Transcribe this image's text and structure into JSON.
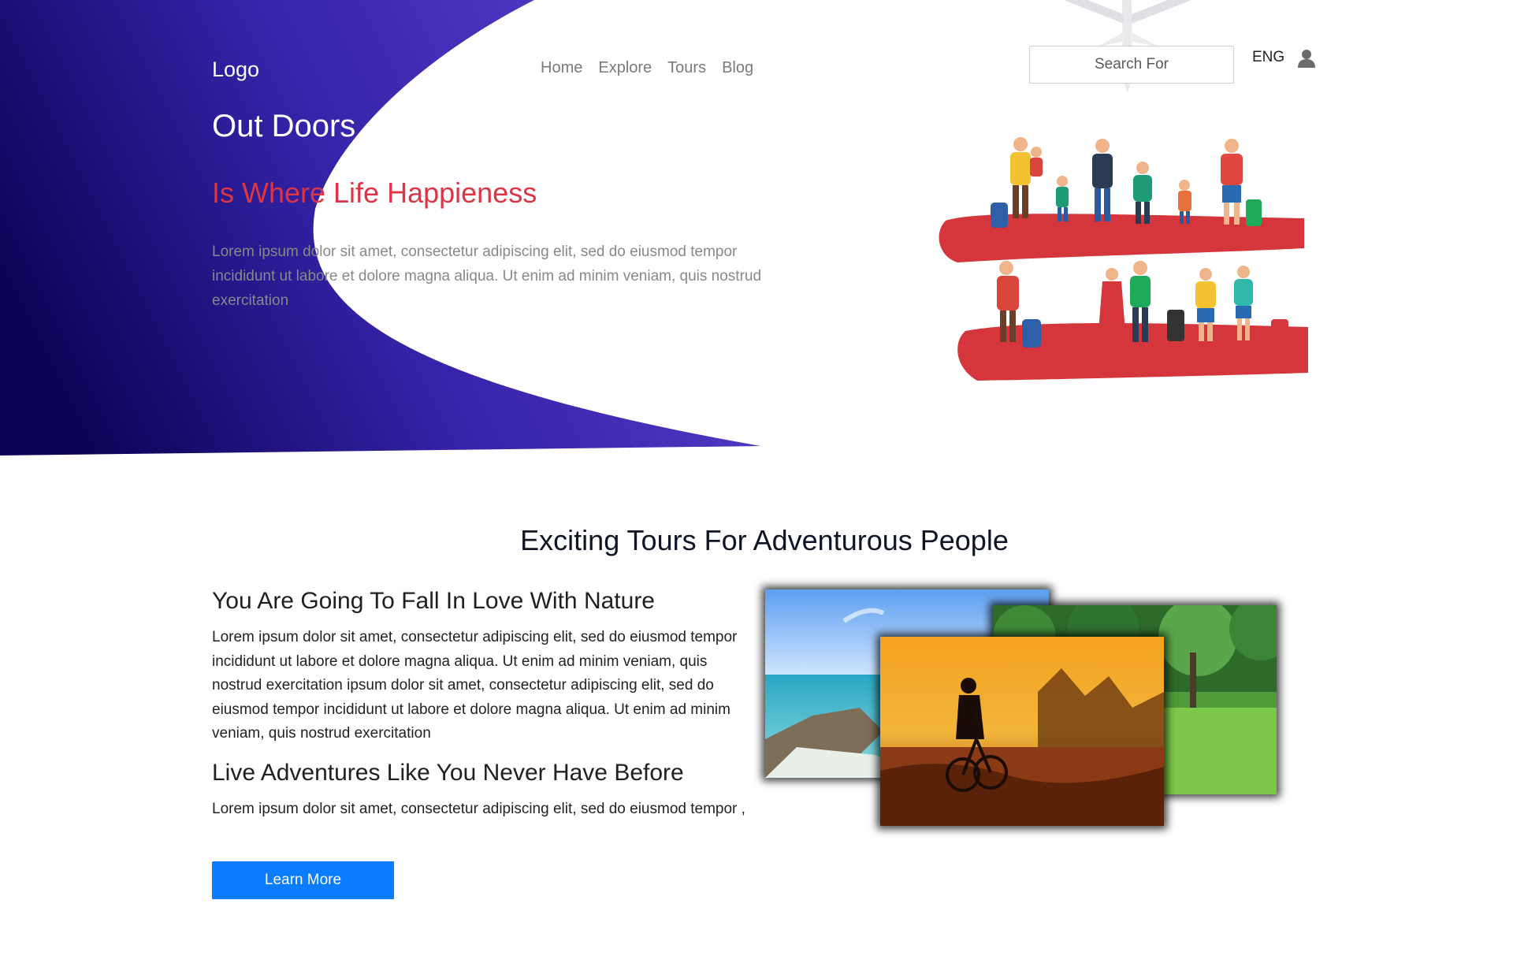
{
  "header": {
    "logo": "Logo",
    "nav": [
      "Home",
      "Explore",
      "Tours",
      "Blog"
    ],
    "search_placeholder": "Search For",
    "language": "ENG"
  },
  "hero": {
    "title": "Out Doors",
    "subtitle": "Is Where Life Happieness",
    "text": "Lorem ipsum dolor sit amet, consectetur adipiscing elit, sed do eiusmod tempor incididunt ut labore et dolore magna aliqua. Ut enim ad minim veniam, quis nostrud exercitation"
  },
  "section": {
    "title": "Exciting Tours For Adventurous People",
    "heading1": "You Are Going To Fall In Love With Nature",
    "para1": "Lorem ipsum dolor sit amet, consectetur adipiscing elit, sed do eiusmod tempor incididunt ut labore et dolore magna aliqua. Ut enim ad minim veniam, quis nostrud exercitation ipsum dolor sit amet, consectetur adipiscing elit, sed do eiusmod tempor incididunt ut labore et dolore magna aliqua. Ut enim ad minim veniam, quis nostrud exercitation",
    "heading2": "Live Adventures Like You Never Have Before",
    "para2": "Lorem ipsum dolor sit amet, consectetur adipiscing elit, sed do eiusmod tempor ,",
    "button": "Learn More"
  },
  "colors": {
    "hero_gradient_start": "#0b0456",
    "hero_gradient_end": "#5a3fce",
    "accent_red": "#dc3545",
    "button_blue": "#0a7cff"
  },
  "icons": [
    "user-icon",
    "airplane-icon"
  ]
}
